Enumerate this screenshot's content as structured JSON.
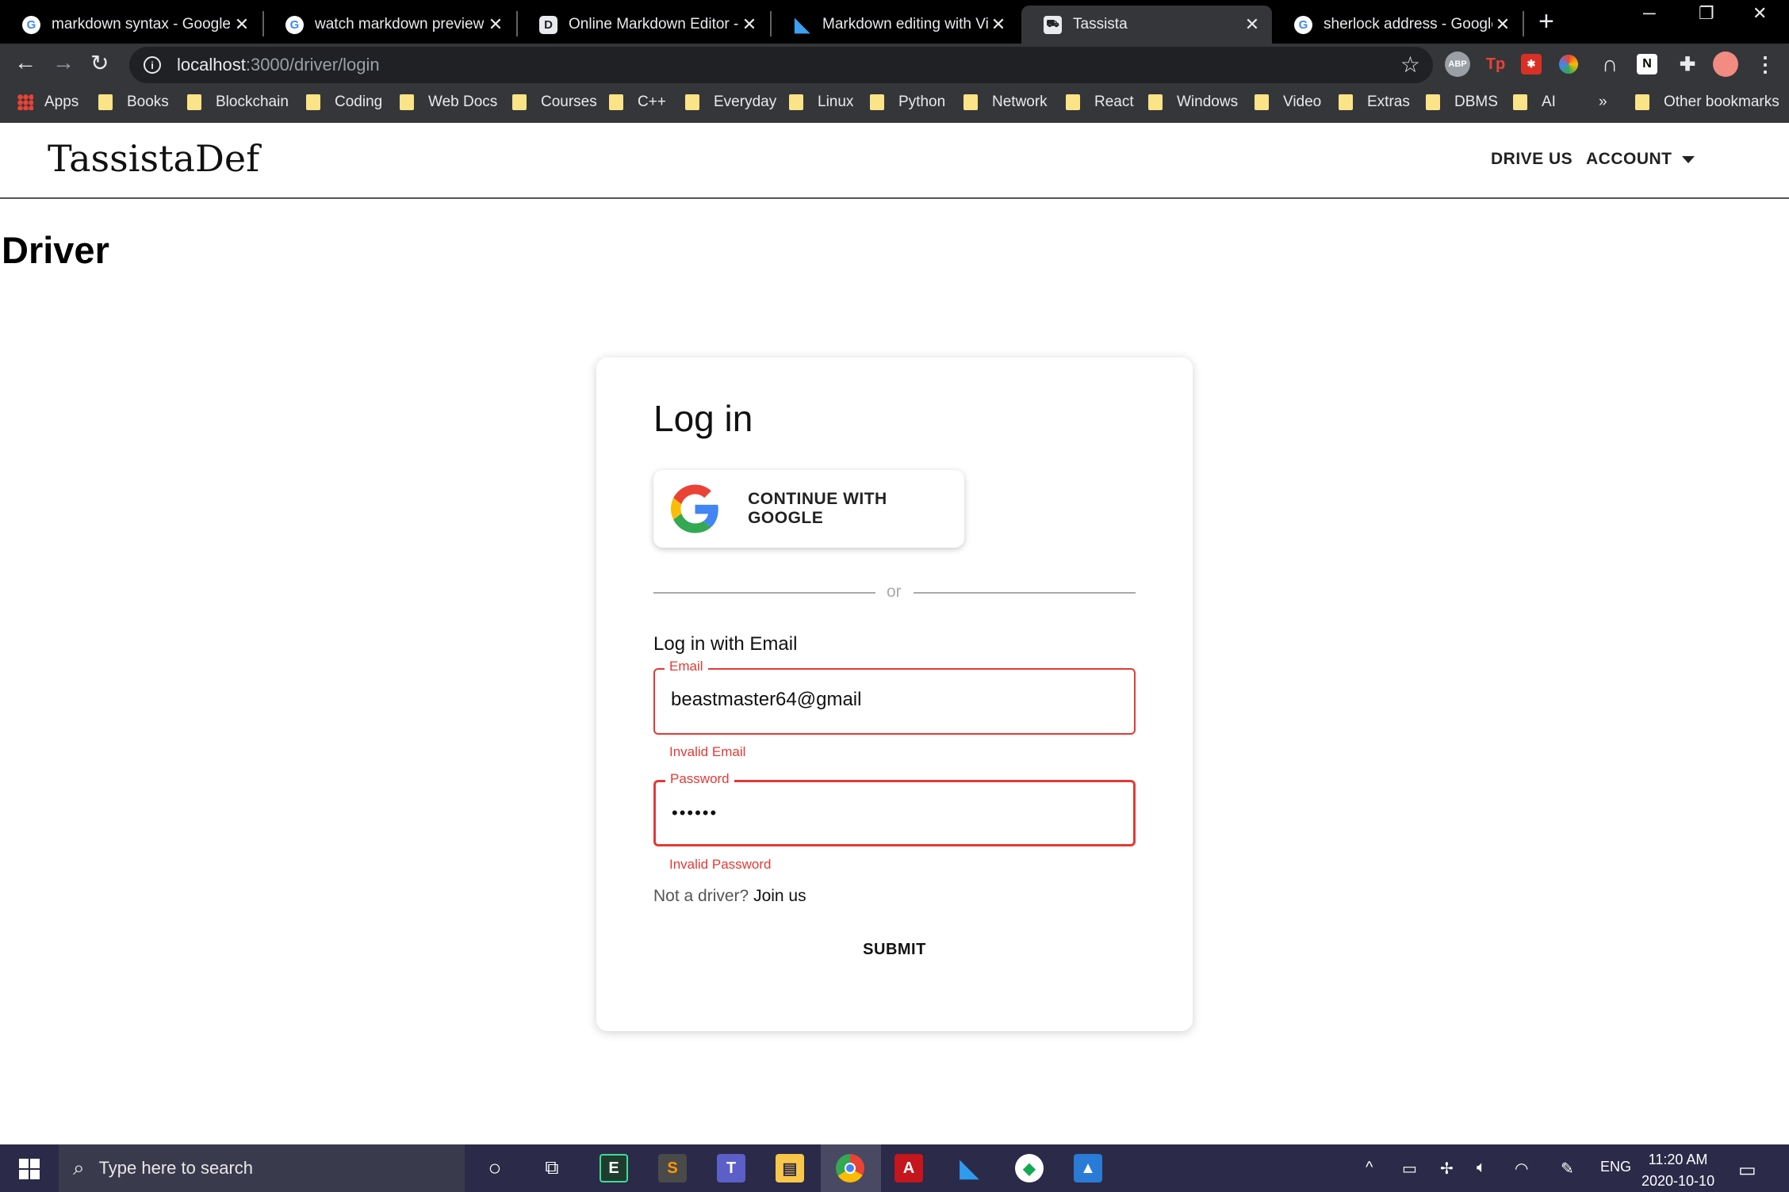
{
  "browser": {
    "tabs": [
      {
        "title": "markdown syntax - Google",
        "favicon": "G"
      },
      {
        "title": "watch markdown preview -",
        "favicon": "G"
      },
      {
        "title": "Online Markdown Editor - D",
        "favicon": "D"
      },
      {
        "title": "Markdown editing with Visu",
        "favicon": "vscode-icon"
      },
      {
        "title": "Tassista",
        "favicon": "tassista-icon"
      },
      {
        "title": "sherlock address - Google S",
        "favicon": "G"
      }
    ],
    "active_tab_index": 4,
    "url_host": "localhost",
    "url_path": ":3000/driver/login",
    "extensions": [
      "ABP",
      "Tp",
      "ext-red-icon",
      "color-picker-icon",
      "arc-icon",
      "N",
      "puzzle-icon",
      "profile-avatar"
    ],
    "bookmarks": [
      "Apps",
      "Books",
      "Blockchain",
      "Coding",
      "Web Docs",
      "Courses",
      "C++",
      "Everyday",
      "Linux",
      "Python",
      "Network",
      "React",
      "Windows",
      "Video",
      "Extras",
      "DBMS",
      "AI"
    ],
    "bookmarks_overflow": "»",
    "other_bookmarks": "Other bookmarks"
  },
  "site": {
    "brand": "TassistaDef",
    "nav": {
      "drive_us": "DRIVE US",
      "account": "ACCOUNT"
    },
    "page_heading": "Driver"
  },
  "login": {
    "title": "Log in",
    "google_button": "CONTINUE WITH GOOGLE",
    "divider_text": "or",
    "email_section": "Log in with Email",
    "email": {
      "label": "Email",
      "value": "beastmaster64@gmail",
      "error": "Invalid Email"
    },
    "password": {
      "label": "Password",
      "value": "••••••",
      "error": "Invalid Password"
    },
    "not_driver": "Not a driver?",
    "join_link": "Join us",
    "submit": "SUBMIT"
  },
  "taskbar": {
    "search_placeholder": "Type here to search",
    "language": "ENG",
    "time": "11:20 AM",
    "date": "2020-10-10"
  },
  "colors": {
    "error": "#e53935",
    "tab_strip": "#000000",
    "toolbar": "#35363a",
    "taskbar": "#2b2a48"
  }
}
